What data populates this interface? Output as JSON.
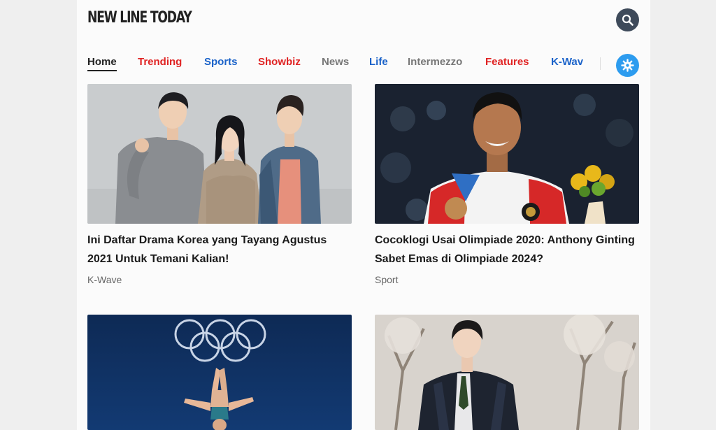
{
  "header": {
    "logo": "NEW LINE TODAY",
    "search_icon": "search-icon"
  },
  "nav": {
    "items": [
      {
        "label": "Home",
        "color": "#222222"
      },
      {
        "label": "Trending",
        "color": "#e02424"
      },
      {
        "label": "Sports",
        "color": "#1a62c9"
      },
      {
        "label": "Showbiz",
        "color": "#e02424"
      },
      {
        "label": "News",
        "color": "#777777"
      },
      {
        "label": "Life",
        "color": "#1a62c9"
      },
      {
        "label": "Intermezzo",
        "color": "#777777"
      },
      {
        "label": "Features",
        "color": "#e02424"
      },
      {
        "label": "K-Wav",
        "color": "#1a62c9"
      }
    ],
    "settings_icon": "gear-icon"
  },
  "articles": [
    {
      "title": "Ini Daftar Drama Korea yang Tayang Agustus 2021 Untuk Temani Kalian!",
      "category": "K-Wave",
      "image": "korean-drama-cast-photo"
    },
    {
      "title": "Cocoklogi Usai Olimpiade 2020: Anthony Ginting Sabet Emas di Olimpiade 2024?",
      "category": "Sport",
      "image": "athlete-with-medal-photo"
    },
    {
      "title": "",
      "category": "",
      "image": "olympic-diver-photo"
    },
    {
      "title": "",
      "category": "",
      "image": "student-in-uniform-photo"
    }
  ]
}
